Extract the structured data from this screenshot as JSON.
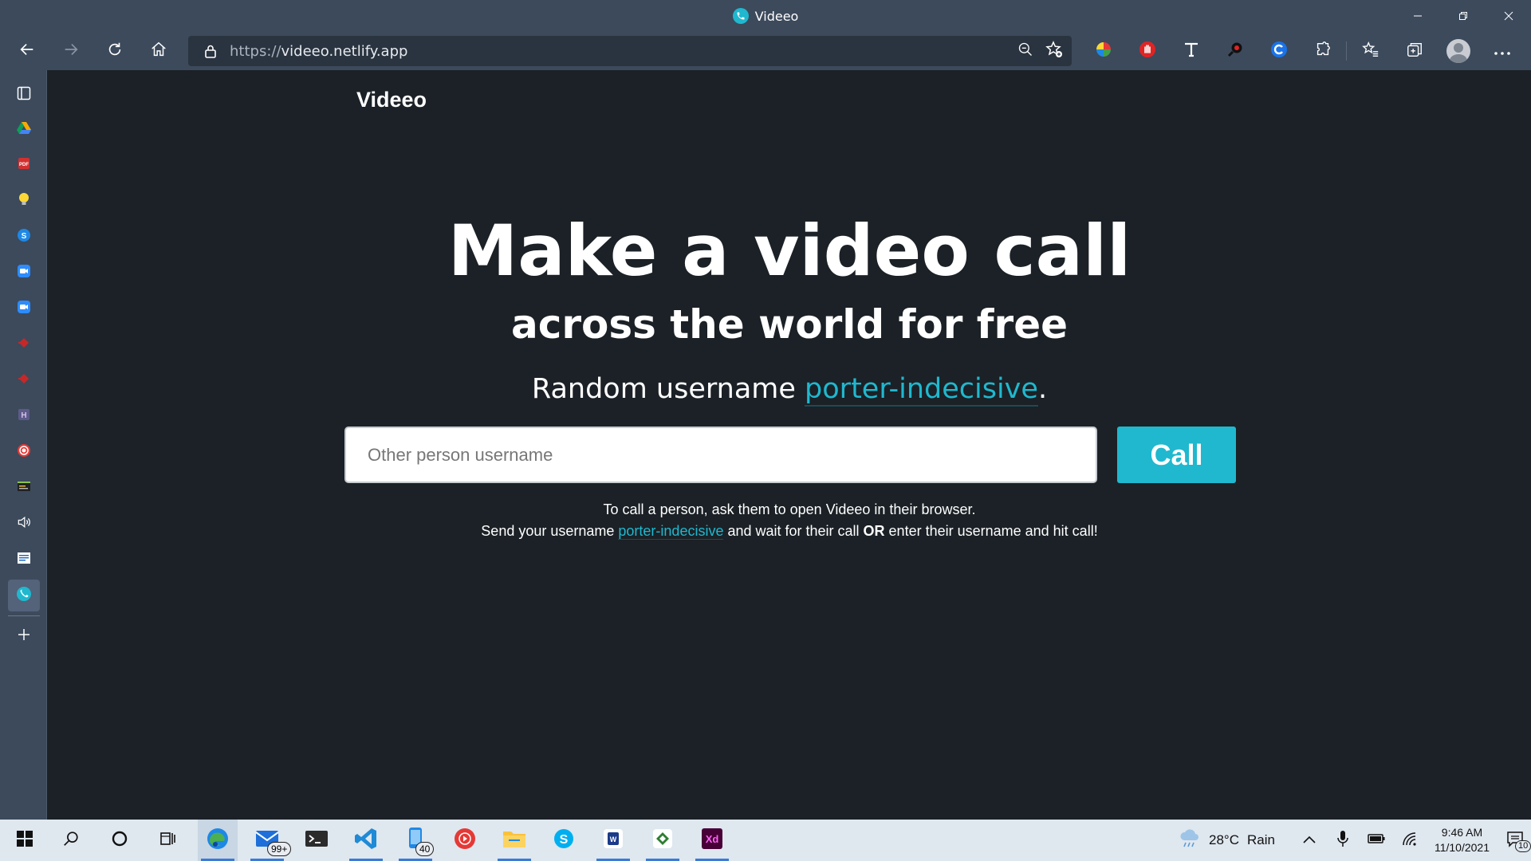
{
  "window": {
    "title": "Videeo"
  },
  "address_bar": {
    "url_scheme": "https://",
    "url_host": "videeo.netlify.app"
  },
  "page": {
    "brand": "Videeo",
    "hero_line1": "Make a video call",
    "hero_line2": "across the world for free",
    "random_prefix": "Random username ",
    "random_username": "porter-indecisive",
    "random_suffix": ".",
    "input_placeholder": "Other person username",
    "call_label": "Call",
    "help_line1": "To call a person, ask them to open Videeo in their browser.",
    "help_line2_a": "Send your username ",
    "help_line2_user": "porter-indecisive",
    "help_line2_b": " and wait for their call ",
    "help_line2_or": "OR",
    "help_line2_c": " enter their username and hit call!"
  },
  "taskbar": {
    "mail_badge": "99+",
    "phone_badge": "40",
    "weather_temp": "28°C",
    "weather_desc": "Rain",
    "time": "9:46 AM",
    "date": "11/10/2021",
    "notification_count": "10"
  },
  "colors": {
    "accent": "#1fb8cf",
    "page_background": "#1b2126",
    "chrome_background": "#3c4a5c",
    "taskbar_background": "#dfe7ef"
  }
}
